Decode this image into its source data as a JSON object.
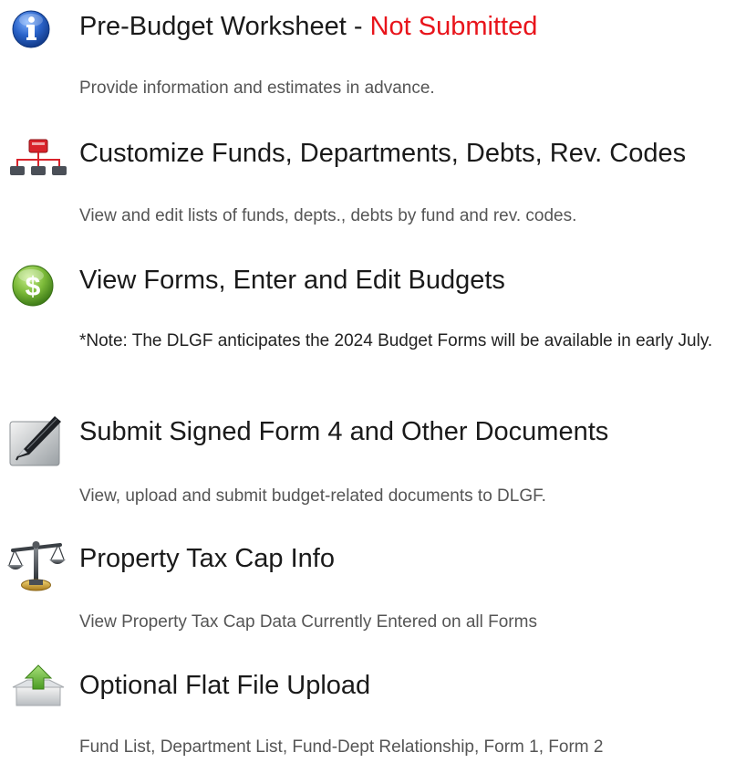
{
  "items": [
    {
      "title": "Pre-Budget Worksheet - ",
      "status": "Not Submitted",
      "description": "Provide information and estimates in advance.",
      "icon": "info-icon"
    },
    {
      "title": "Customize Funds, Departments, Debts, Rev. Codes",
      "description": "View and edit lists of funds, depts., debts by fund and rev. codes.",
      "icon": "org-chart-icon"
    },
    {
      "title": "View Forms, Enter and Edit Budgets",
      "description": "*Note: The DLGF anticipates the 2024 Budget Forms will be available in early July.",
      "icon": "dollar-icon"
    },
    {
      "title": "Submit Signed Form 4 and Other Documents",
      "description": "View, upload and submit budget-related documents to DLGF.",
      "icon": "pen-icon"
    },
    {
      "title": "Property Tax Cap Info",
      "description": "View Property Tax Cap Data Currently Entered on all Forms",
      "icon": "scales-icon"
    },
    {
      "title": "Optional Flat File Upload",
      "description": "Fund List, Department List, Fund-Dept Relationship, Form 1, Form 2",
      "icon": "upload-box-icon"
    }
  ],
  "colors": {
    "status_red": "#e8141b",
    "info_blue": "#2a63c9",
    "org_red": "#d9232b",
    "dollar_green": "#7dbb3a"
  }
}
